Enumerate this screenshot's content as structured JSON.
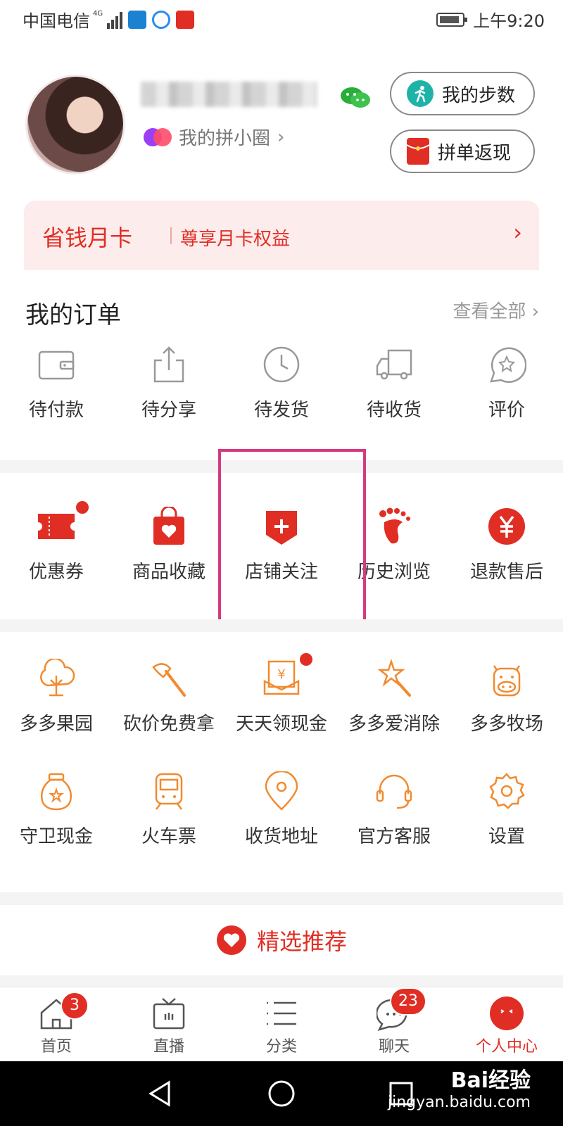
{
  "status_bar": {
    "carrier": "中国电信",
    "network": "4G",
    "time": "上午9:20"
  },
  "profile": {
    "circle_link": "我的拼小圈",
    "buttons": [
      {
        "label": "我的步数",
        "icon": "running-icon"
      },
      {
        "label": "拼单返现",
        "icon": "red-envelope-icon"
      }
    ]
  },
  "month_card": {
    "title": "省钱月卡",
    "subtitle": "尊享月卡权益"
  },
  "orders": {
    "title": "我的订单",
    "view_all": "查看全部",
    "items": [
      {
        "label": "待付款",
        "icon": "wallet-icon"
      },
      {
        "label": "待分享",
        "icon": "share-icon"
      },
      {
        "label": "待发货",
        "icon": "clock-icon"
      },
      {
        "label": "待收货",
        "icon": "truck-icon"
      },
      {
        "label": "评价",
        "icon": "star-bubble-icon"
      }
    ]
  },
  "quick_links": [
    {
      "label": "优惠券",
      "icon": "coupon-icon"
    },
    {
      "label": "商品收藏",
      "icon": "heart-bag-icon"
    },
    {
      "label": "店铺关注",
      "icon": "store-plus-icon"
    },
    {
      "label": "历史浏览",
      "icon": "footprint-icon"
    },
    {
      "label": "退款售后",
      "icon": "yuan-icon"
    }
  ],
  "features_row1": [
    {
      "label": "多多果园",
      "icon": "tree-icon"
    },
    {
      "label": "砍价免费拿",
      "icon": "axe-icon"
    },
    {
      "label": "天天领现金",
      "icon": "cash-envelope-icon"
    },
    {
      "label": "多多爱消除",
      "icon": "star-wand-icon"
    },
    {
      "label": "多多牧场",
      "icon": "cow-icon"
    }
  ],
  "features_row2": [
    {
      "label": "守卫现金",
      "icon": "money-bag-icon"
    },
    {
      "label": "火车票",
      "icon": "train-icon"
    },
    {
      "label": "收货地址",
      "icon": "location-pin-icon"
    },
    {
      "label": "官方客服",
      "icon": "headset-icon"
    },
    {
      "label": "设置",
      "icon": "gear-icon"
    }
  ],
  "recommend": {
    "label": "精选推荐"
  },
  "tabs": [
    {
      "label": "首页",
      "badge": "3"
    },
    {
      "label": "直播",
      "badge": ""
    },
    {
      "label": "分类",
      "badge": ""
    },
    {
      "label": "聊天",
      "badge": "23"
    },
    {
      "label": "个人中心",
      "badge": ""
    }
  ],
  "watermark": {
    "line1": "Bai经验",
    "line2": "jingyan.baidu.com"
  },
  "colors": {
    "accent": "#e02e24",
    "feature_orange": "#f28a2e",
    "highlight": "#d43a7f"
  }
}
